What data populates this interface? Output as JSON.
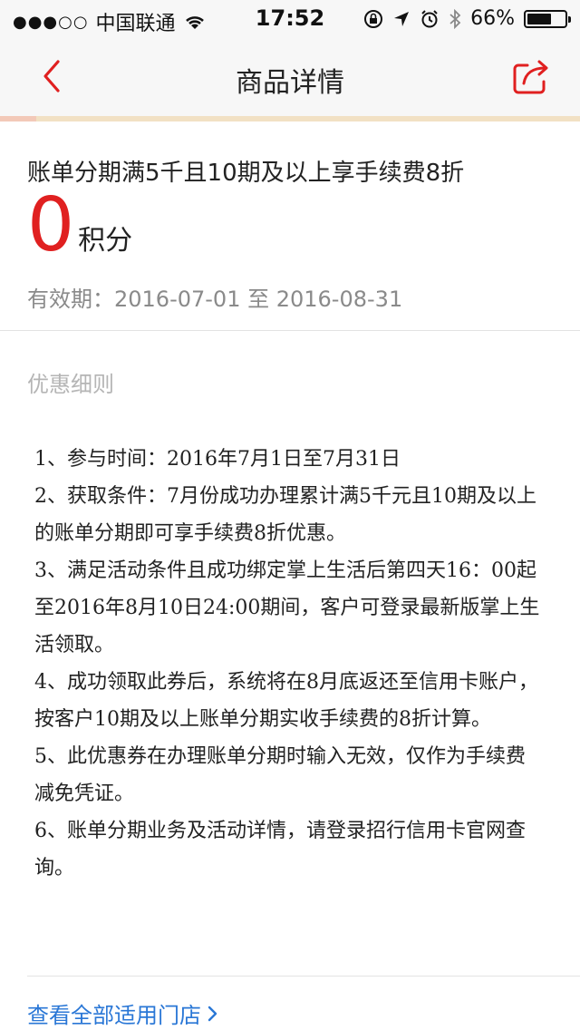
{
  "status_bar": {
    "signal_dots": "●●●○○",
    "carrier": "中国联通",
    "time": "17:52",
    "battery_percent": "66%",
    "battery_level": 0.66
  },
  "nav": {
    "title": "商品详情",
    "accent_color": "#e02020"
  },
  "promo": {
    "title": "账单分期满5千且10期及以上享手续费8折",
    "points_value": "0",
    "points_unit": "积分",
    "validity": "有效期：2016-07-01 至 2016-08-31"
  },
  "rules": {
    "heading": "优惠细则",
    "items": [
      "1、参与时间：2016年7月1日至7月31日",
      "2、获取条件：7月份成功办理累计满5千元且10期及以上的账单分期即可享手续费8折优惠。",
      "3、满足活动条件且成功绑定掌上生活后第四天16：00起至2016年8月10日24:00期间，客户可登录最新版掌上生活领取。",
      "4、成功领取此券后，系统将在8月底返还至信用卡账户，按客户10期及以上账单分期实收手续费的8折计算。",
      "5、此优惠券在办理账单分期时输入无效，仅作为手续费减免凭证。",
      "6、账单分期业务及活动详情，请登录招行信用卡官网查询。"
    ]
  },
  "footer": {
    "store_link": "查看全部适用门店",
    "link_color": "#2a77d6"
  }
}
